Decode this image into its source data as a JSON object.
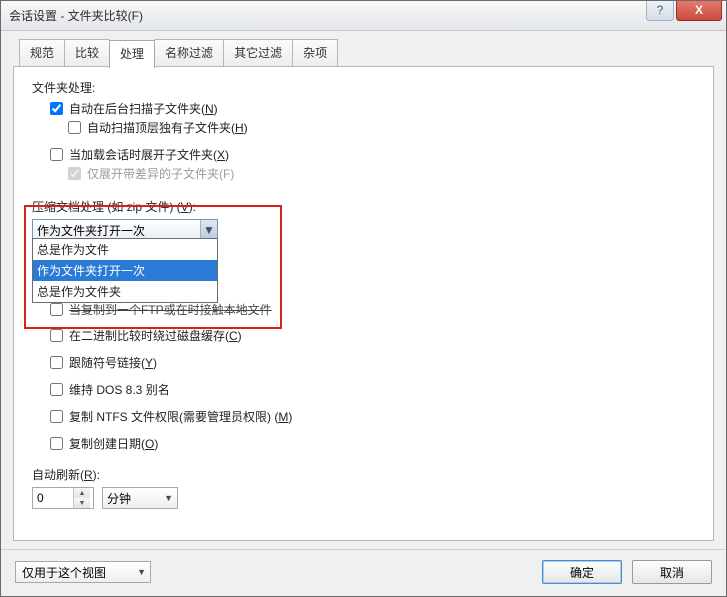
{
  "window": {
    "title": "会话设置 - 文件夹比较(F)",
    "help": "?",
    "close": "X"
  },
  "tabs": [
    "规范",
    "比较",
    "处理",
    "名称过滤",
    "其它过滤",
    "杂项"
  ],
  "sections": {
    "folder_handling": "文件夹处理:",
    "auto_scan_sub": "自动在后台扫描子文件夹(",
    "auto_scan_sub_key": "N",
    "auto_scan_orphan": "自动扫描顶层独有子文件夹(",
    "auto_scan_orphan_key": "H",
    "expand_on_load": "当加载会话时展开子文件夹(",
    "expand_on_load_key": "X",
    "only_diff_sub": "仅展开带差异的子文件夹(F)",
    "archive_label_pre": "压缩文档处理 (如 zip 文件) (",
    "archive_label_key": "V",
    "archive_label_post": "):",
    "archive_selected": "作为文件夹打开一次",
    "archive_options": [
      "总是作为文件",
      "作为文件夹打开一次",
      "总是作为文件夹"
    ],
    "covered_line": "当复制到一个FTP或在时接触本地文件",
    "bypass_cache": "在二进制比较时绕过磁盘缓存(",
    "bypass_cache_key": "C",
    "follow_symlinks": "跟随符号链接(",
    "follow_symlinks_key": "Y",
    "dos83": "维持 DOS 8.3 别名",
    "ntfs": "复制 NTFS 文件权限(需要管理员权限) (",
    "ntfs_key": "M",
    "copy_created": "复制创建日期(",
    "copy_created_key": "O",
    "auto_refresh": "自动刷新(",
    "auto_refresh_key": "R",
    "auto_refresh_post": "):",
    "refresh_value": "0",
    "refresh_unit": "分钟"
  },
  "footer": {
    "scope": "仅用于这个视图",
    "ok": "确定",
    "cancel": "取消"
  },
  "close_paren": ")"
}
